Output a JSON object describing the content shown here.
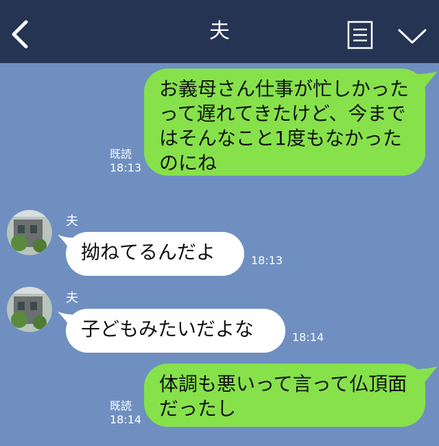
{
  "header": {
    "title": "夫",
    "back_icon": "chevron-left-icon",
    "menu_icon": "list-icon",
    "expand_icon": "chevron-down-icon"
  },
  "colors": {
    "header_bg": "#243452",
    "chat_bg": "#6f8fc0",
    "outgoing_bubble": "#86e14b",
    "incoming_bubble": "#ffffff"
  },
  "messages": [
    {
      "side": "out",
      "text": "お義母さん仕事が忙しかったって遅れてきたけど、今まではそんなこと1度もなかったのにね",
      "read": "既読",
      "time": "18:13"
    },
    {
      "side": "in",
      "sender": "夫",
      "text": "拗ねてるんだよ",
      "time": "18:13"
    },
    {
      "side": "in",
      "sender": "夫",
      "text": "子どもみたいだよな",
      "time": "18:14"
    },
    {
      "side": "out",
      "text": "体調も悪いって言って仏頂面だったし",
      "read": "既読",
      "time": "18:14"
    }
  ]
}
